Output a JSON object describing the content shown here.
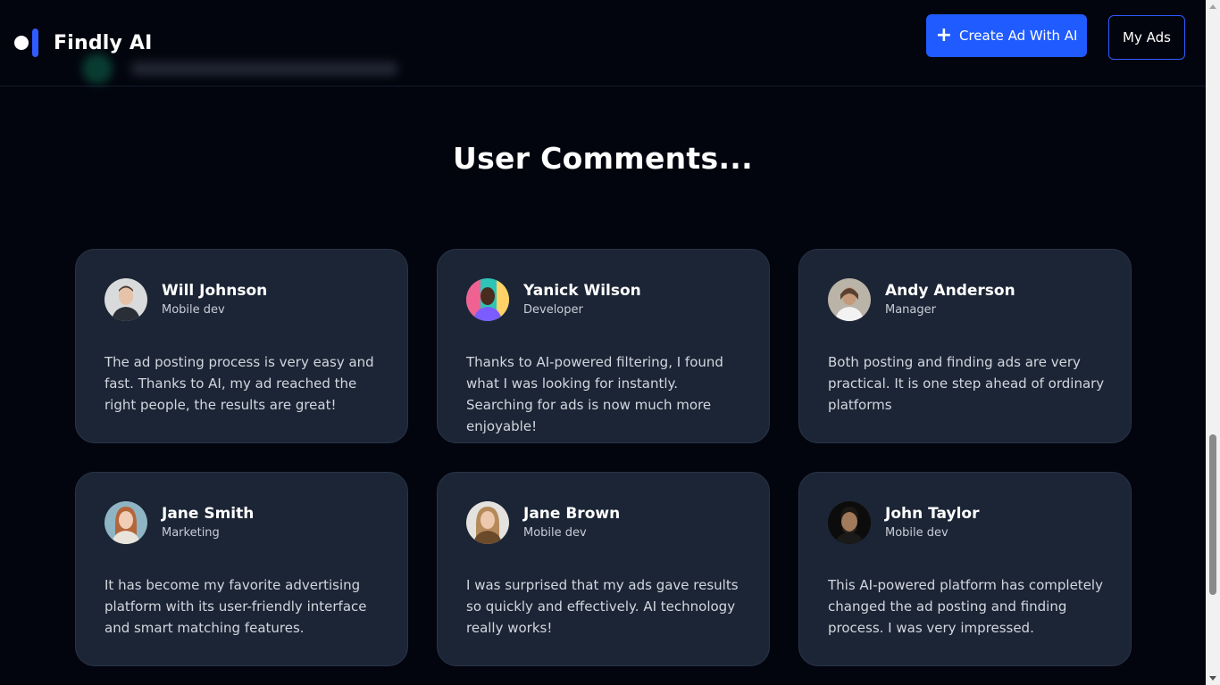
{
  "header": {
    "brand_name": "Findly AI",
    "create_button_label": "Create Ad With AI",
    "my_ads_button_label": "My Ads"
  },
  "section": {
    "title": "User Comments..."
  },
  "comments": [
    {
      "name": "Will Johnson",
      "role": "Mobile dev",
      "text": "The ad posting process is very easy and fast. Thanks to AI, my ad reached the right people, the results are great!"
    },
    {
      "name": "Yanick Wilson",
      "role": "Developer",
      "text": "Thanks to AI-powered filtering, I found what I was looking for instantly. Searching for ads is now much more enjoyable!"
    },
    {
      "name": "Andy Anderson",
      "role": "Manager",
      "text": "Both posting and finding ads are very practical. It is one step ahead of ordinary platforms"
    },
    {
      "name": "Jane Smith",
      "role": "Marketing",
      "text": "It has become my favorite advertising platform with its user-friendly interface and smart matching features."
    },
    {
      "name": "Jane Brown",
      "role": "Mobile dev",
      "text": "I was surprised that my ads gave results so quickly and effectively. AI technology really works!"
    },
    {
      "name": "John Taylor",
      "role": "Mobile dev",
      "text": "This AI-powered platform has completely changed the ad posting and finding process. I was very impressed."
    }
  ],
  "colors": {
    "background": "#03050e",
    "accent": "#1f5bff",
    "card": "#1c2535"
  }
}
